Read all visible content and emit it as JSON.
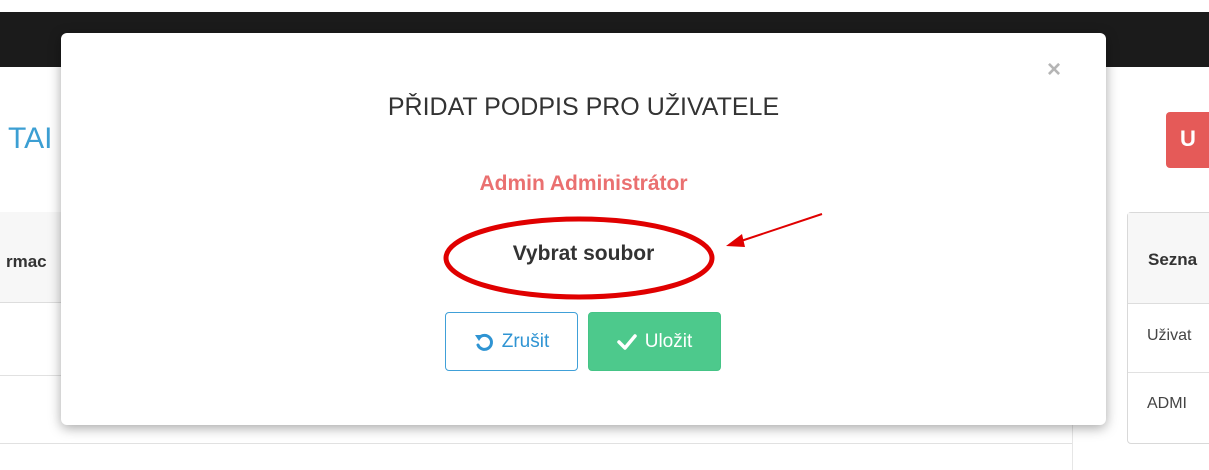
{
  "background_page": {
    "title_fragment": "TAI",
    "left_table_header_fragment": "rmac",
    "right_table": {
      "header_fragment": "Sezna",
      "rows": [
        "Uživat",
        "ADMI"
      ]
    },
    "red_button_icon": "user-icon"
  },
  "modal": {
    "title": "PŘIDAT PODPIS PRO UŽIVATELE",
    "user_name": "Admin Administrátor",
    "file_select_label": "Vybrat soubor",
    "close_icon": "close-icon",
    "buttons": {
      "cancel_label": "Zrušit",
      "cancel_icon": "undo-icon",
      "save_label": "Uložit",
      "save_icon": "check-icon"
    }
  },
  "colors": {
    "topbar": "#1b1b1b",
    "user_name": "#ea7070",
    "cancel_accent": "#2f94d3",
    "save_bg": "#4dc98c",
    "annotation_red": "#e00000"
  }
}
